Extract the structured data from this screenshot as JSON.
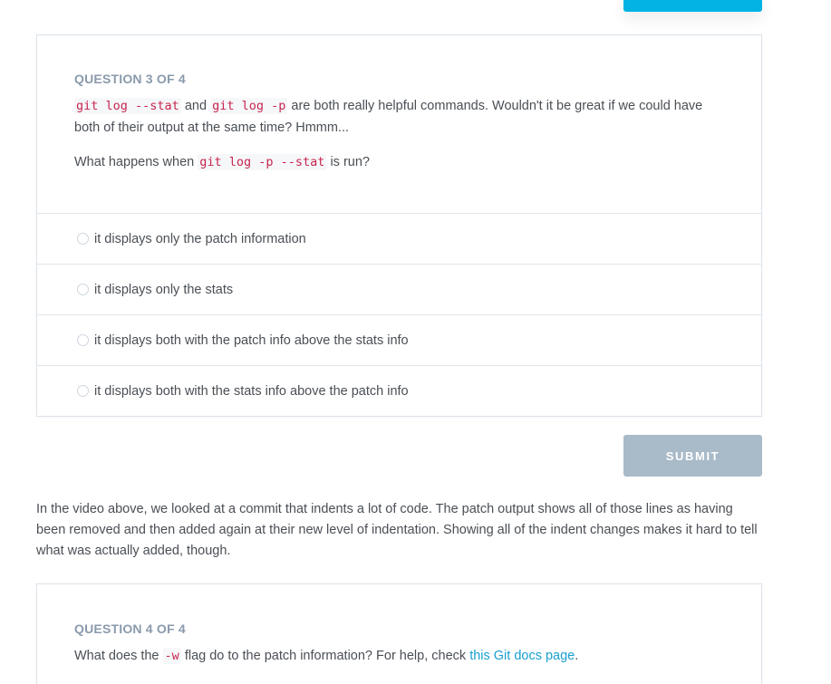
{
  "question3": {
    "label": "QUESTION 3 OF 4",
    "code_stat": "git log --stat",
    "text_and": "and",
    "code_p": "git log -p",
    "text_rest": "are both really helpful commands. Wouldn't it be great if we could have both of their output at the same time? Hmmm...",
    "prompt_before": "What happens when",
    "prompt_code": "git log -p --stat",
    "prompt_after": "is run?",
    "options": [
      {
        "label": "it displays only the patch information"
      },
      {
        "label": "it displays only the stats"
      },
      {
        "label": "it displays both with the patch info above the stats info"
      },
      {
        "label": "it displays both with the stats info above the patch info"
      }
    ],
    "submit_label": "SUBMIT"
  },
  "body_paragraph": "In the video above, we looked at a commit that indents a lot of code. The patch output shows all of those lines as having been removed and then added again at their new level of indentation. Showing all of the indent changes makes it hard to tell what was actually added, though.",
  "question4": {
    "label": "QUESTION 4 OF 4",
    "text_before": "What does the",
    "code_w": "-w",
    "text_middle": "flag do to the patch information? For help, check",
    "link_text": "this Git docs page",
    "text_after": "."
  },
  "colors": {
    "accent": "#02b3e4",
    "submit_disabled": "#a9bac8",
    "link": "#1a9fcf",
    "code": "#c7254e"
  }
}
